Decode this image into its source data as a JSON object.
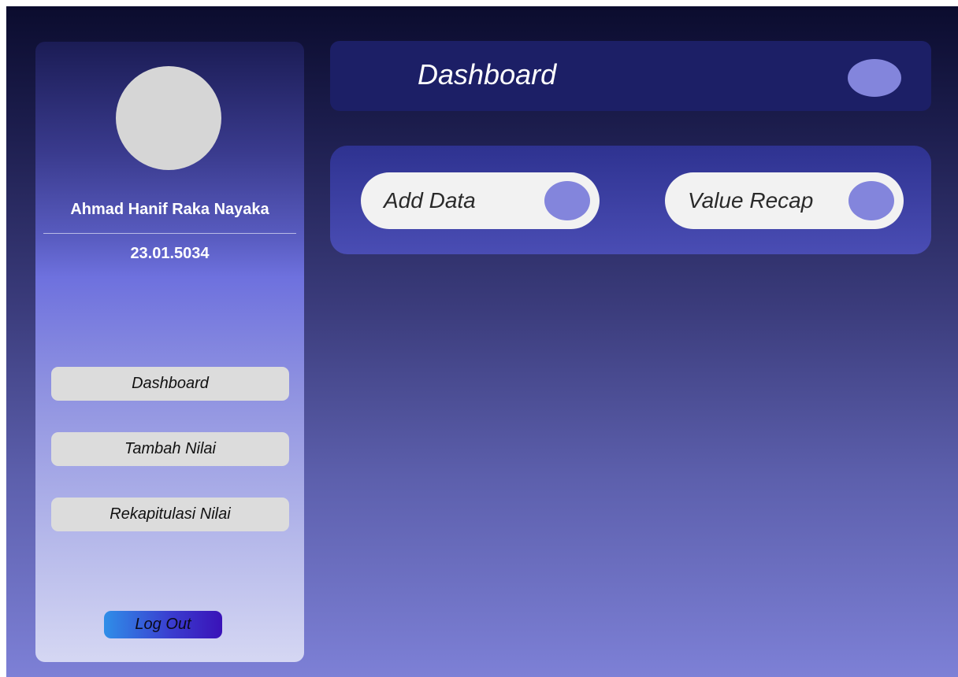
{
  "sidebar": {
    "user_name": "Ahmad Hanif Raka Nayaka",
    "user_id": "23.01.5034",
    "nav_items": [
      {
        "label": "Dashboard"
      },
      {
        "label": "Tambah Nilai"
      },
      {
        "label": "Rekapitulasi Nilai"
      }
    ],
    "logout_label": "Log Out"
  },
  "header": {
    "title": "Dashboard"
  },
  "actions": [
    {
      "label": "Add Data"
    },
    {
      "label": "Value Recap"
    }
  ],
  "colors": {
    "accent": "#8385dc",
    "header_bg": "#1c1f66",
    "button_bg": "#dcdcdc",
    "pill_bg": "#f2f2f2"
  }
}
